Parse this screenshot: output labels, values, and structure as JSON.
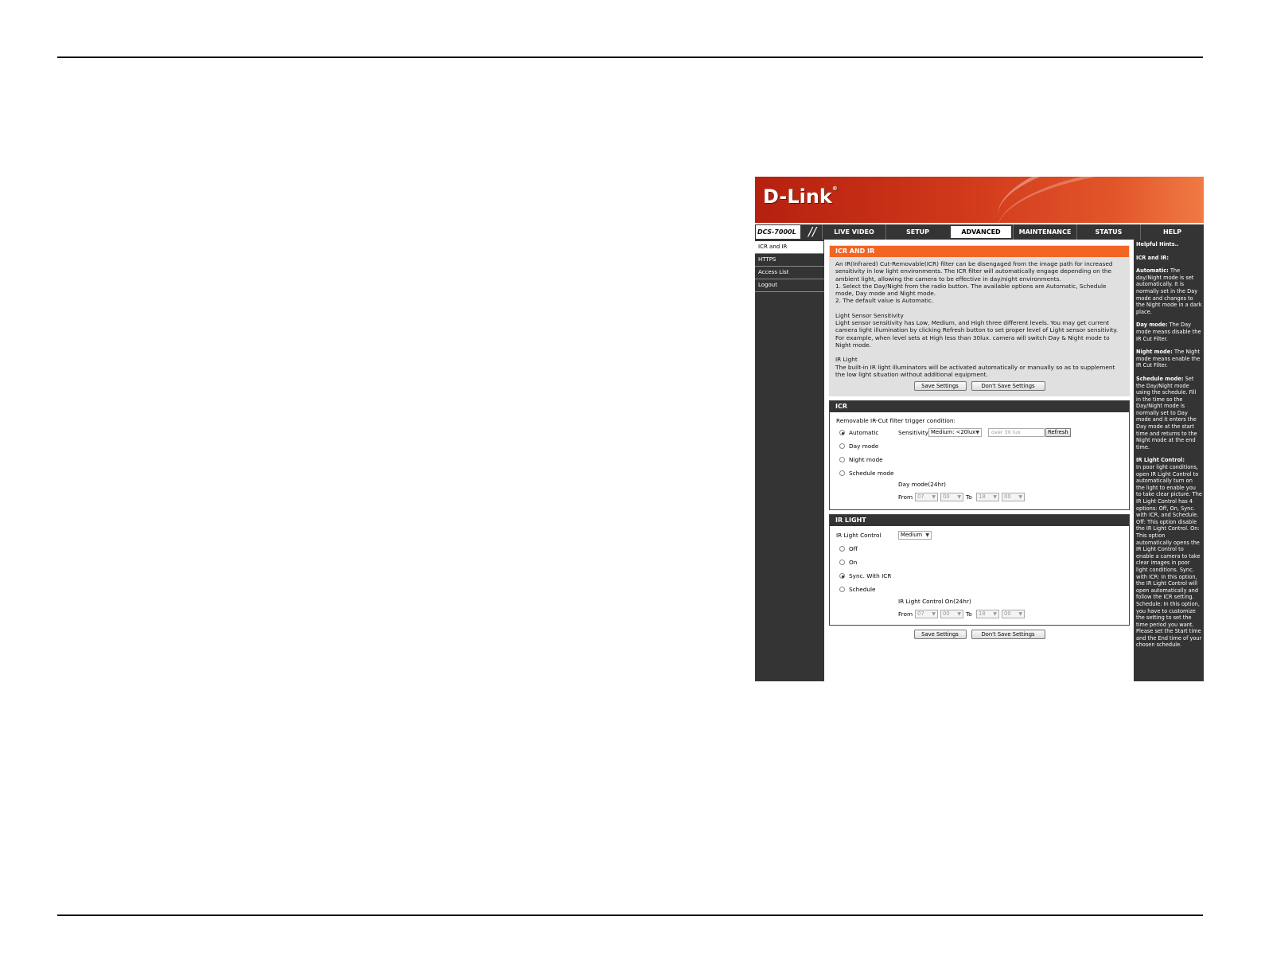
{
  "window": {
    "brand": "D-Link",
    "model": "DCS-7000L"
  },
  "nav": {
    "tabs": [
      {
        "label": "LIVE VIDEO"
      },
      {
        "label": "SETUP"
      },
      {
        "label": "ADVANCED"
      },
      {
        "label": "MAINTENANCE"
      },
      {
        "label": "STATUS"
      },
      {
        "label": "HELP"
      }
    ],
    "active_tab": "ADVANCED"
  },
  "sidebar": {
    "items": [
      {
        "label": "ICR and IR"
      },
      {
        "label": "HTTPS"
      },
      {
        "label": "Access List"
      },
      {
        "label": "Logout"
      }
    ],
    "active": "ICR and IR"
  },
  "intro": {
    "title": "ICR AND IR",
    "p1": "An IR(Infrared) Cut-Removable(ICR) filter can be disengaged from the image path for increased sensitivity in low light environments. The ICR filter will automatically engage depending on the ambient light, allowing the camera to be effective in day/night environments.",
    "p2": "1. Select the Day/Night from the radio button. The available options are Automatic, Schedule mode, Day mode and Night mode.",
    "p3": "2. The default value is Automatic.",
    "p4_title": "Light Sensor Sensitivity",
    "p4": "Light sensor sensitivity has Low, Medium, and High three different levels. You may get current camera light illumination by clicking Refresh button to set proper level of Light sensor sensitivity. For example, when level sets at High less than 30lux. camera will switch Day & Night mode to Night mode.",
    "p5_title": "IR Light",
    "p5": "The built-in IR light illuminators will be activated automatically or manually so as to supplement the low light situation without additional equipment.",
    "save_label": "Save Settings",
    "nosave_label": "Don't Save Settings"
  },
  "icr": {
    "title": "ICR",
    "trigger_label": "Removable IR-Cut filter trigger condition:",
    "modes": [
      {
        "label": "Automatic",
        "selected": true
      },
      {
        "label": "Day mode",
        "selected": false
      },
      {
        "label": "Night mode",
        "selected": false
      },
      {
        "label": "Schedule mode",
        "selected": false
      }
    ],
    "sensitivity_label": "Sensitivity",
    "sensitivity_value": "Medium: <20lux",
    "lux_placeholder": "over 30 lux",
    "refresh_label": "Refresh",
    "day_mode_label": "Day mode(24hr)",
    "from_label": "From",
    "to_label": "To",
    "from_hour": "07",
    "from_min": "00",
    "to_hour": "18",
    "to_min": "00"
  },
  "irlight": {
    "title": "IR LIGHT",
    "control_label": "IR Light Control",
    "control_value": "Medium",
    "modes": [
      {
        "label": "Off",
        "selected": false
      },
      {
        "label": "On",
        "selected": false
      },
      {
        "label": "Sync. With ICR",
        "selected": true
      },
      {
        "label": "Schedule",
        "selected": false
      }
    ],
    "on_label": "IR Light Control On(24hr)",
    "from_label": "From",
    "to_label": "To",
    "from_hour": "07",
    "from_min": "00",
    "to_hour": "18",
    "to_min": "00"
  },
  "footer": {
    "save_label": "Save Settings",
    "nosave_label": "Don't Save Settings"
  },
  "hints": {
    "title": "Helpful Hints..",
    "section": "ICR and IR:",
    "automatic_title": "Automatic:",
    "automatic": "The day/Night mode is set automatically. It is normally set in the Day mode and changes to the Night mode in a dark place.",
    "day_title": "Day mode:",
    "day": "The Day mode means disable the IR Cut Filter.",
    "night_title": "Night mode:",
    "night": "The Night mode means enable the IR Cut Filter.",
    "schedule_title": "Schedule mode:",
    "schedule": "Set the Day/Night mode using the schedule. Fill in the time so the Day/Night mode is normally set to Day mode and it enters the Day mode at the start time and returns to the Night mode at the end time.",
    "ir_title": "IR Light Control:",
    "ir": "In poor light conditions, open IR Light Control to automatically turn on the light to enable you to take clear picture. The IR Light Control has 4 options: Off, On, Sync. with ICR, and Schedule. Off: This option disable the IR Light Control. On: This option automatically opens the IR Light Control to enable a camera to take clear images in poor light conditions. Sync. with ICR: In this option, the IR Light Control will open automatically and follow the ICR setting. Schedule: In this option, you have to customize the setting to set the time period you want. Please set the Start time and the End time of your chosen schedule."
  }
}
